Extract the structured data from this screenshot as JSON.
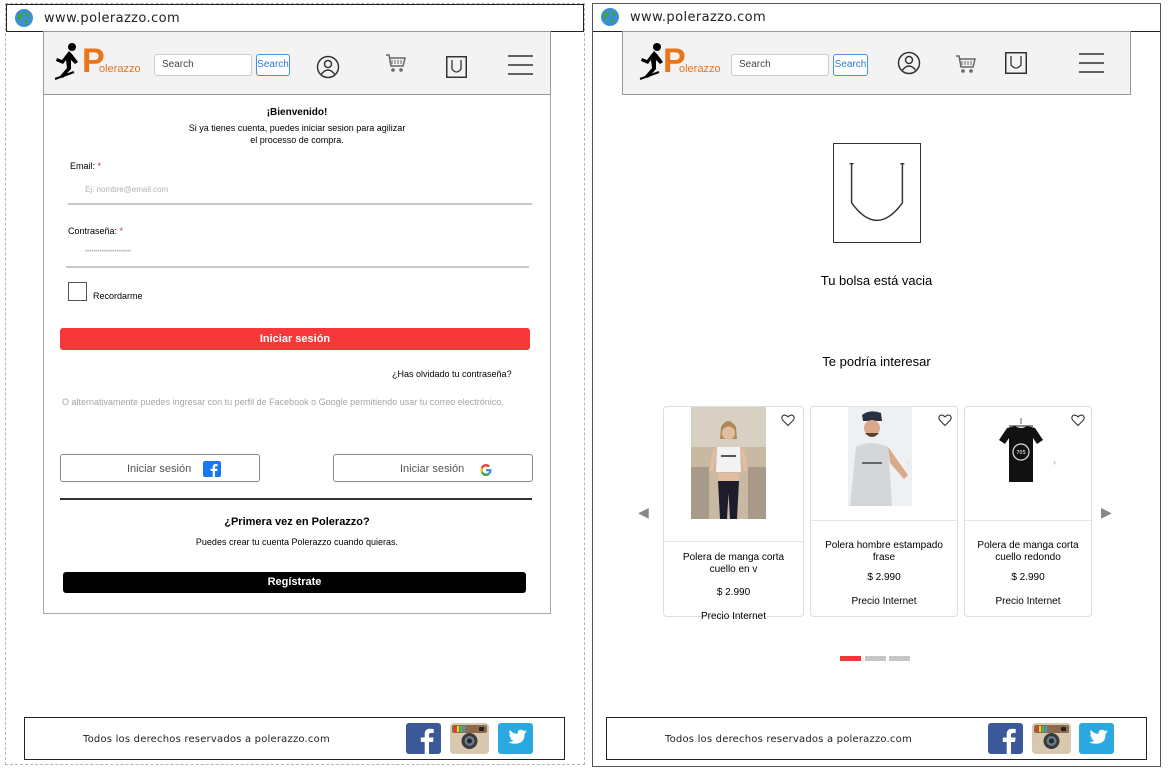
{
  "browser": {
    "url_left": "www.polerazzo.com",
    "url_right": "www.polerazzo.com"
  },
  "header": {
    "logo_letter": "P",
    "logo_rest": "olerazzo",
    "search_placeholder": "Search",
    "search_button": "Search",
    "icons": [
      "user-icon",
      "cart-icon",
      "bag-icon",
      "menu-icon"
    ]
  },
  "login": {
    "welcome": "¡Bienvenido!",
    "subtext_line1": "Si ya tienes cuenta, puedes iniciar sesion para agilizar",
    "subtext_line2": "el processo de compra.",
    "email_label": "Email:",
    "email_placeholder": "Ej: nombre@email.com",
    "password_label": "Contraseña:",
    "password_placeholder": "••••••••••••••••••••••",
    "required_mark": "*",
    "remember_label": "Recordarme",
    "login_button": "Iniciar sesión",
    "forgot_link": "¿Has olvidado tu contraseña?",
    "alternative_text": "O alternativamente puedes ingresar con tu perfil de Facebook o Google permitiendo usar tu correo electrónico.",
    "facebook_button": "Iniciar sesión",
    "google_button": "Iniciar sesión",
    "first_time_title": "¿Primera vez en Polerazzo?",
    "create_account_text": "Puedes crear tu cuenta Polerazzo cuando quieras.",
    "register_button": "Regístrate"
  },
  "cart": {
    "empty_message": "Tu bolsa está vacia",
    "suggestions_title": "Te podría interesar",
    "products": [
      {
        "title": "Polera de manga corta cuello en v",
        "price": "$ 2.990",
        "note": "Precio Internet"
      },
      {
        "title": "Polera hombre estampado frase",
        "price": "$ 2.990",
        "note": "Precio Internet"
      },
      {
        "title": "Polera de manga corta cuello redondo",
        "price": "$ 2.990",
        "note": "Precio Internet"
      }
    ],
    "carousel_pages": 3,
    "carousel_active": 1
  },
  "footer": {
    "copyright": "Todos los derechos reservados a polerazzo.com",
    "social": [
      "facebook-icon",
      "instagram-icon",
      "twitter-icon"
    ]
  },
  "colors": {
    "brand_orange": "#e8751a",
    "login_red": "#f8373a",
    "search_blue": "#2a7bd0"
  }
}
